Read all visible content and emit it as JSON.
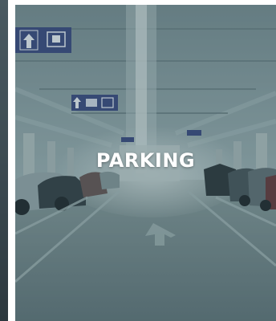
{
  "caption": "PARKING",
  "photo": {
    "subject": "underground-parking-garage",
    "signs": [
      {
        "icon": "arrow-up-icon",
        "bg": "#2d3d77"
      },
      {
        "icon": "elevator-icon",
        "bg": "#2d3d77"
      }
    ],
    "overlay_color": "#4e6870"
  }
}
